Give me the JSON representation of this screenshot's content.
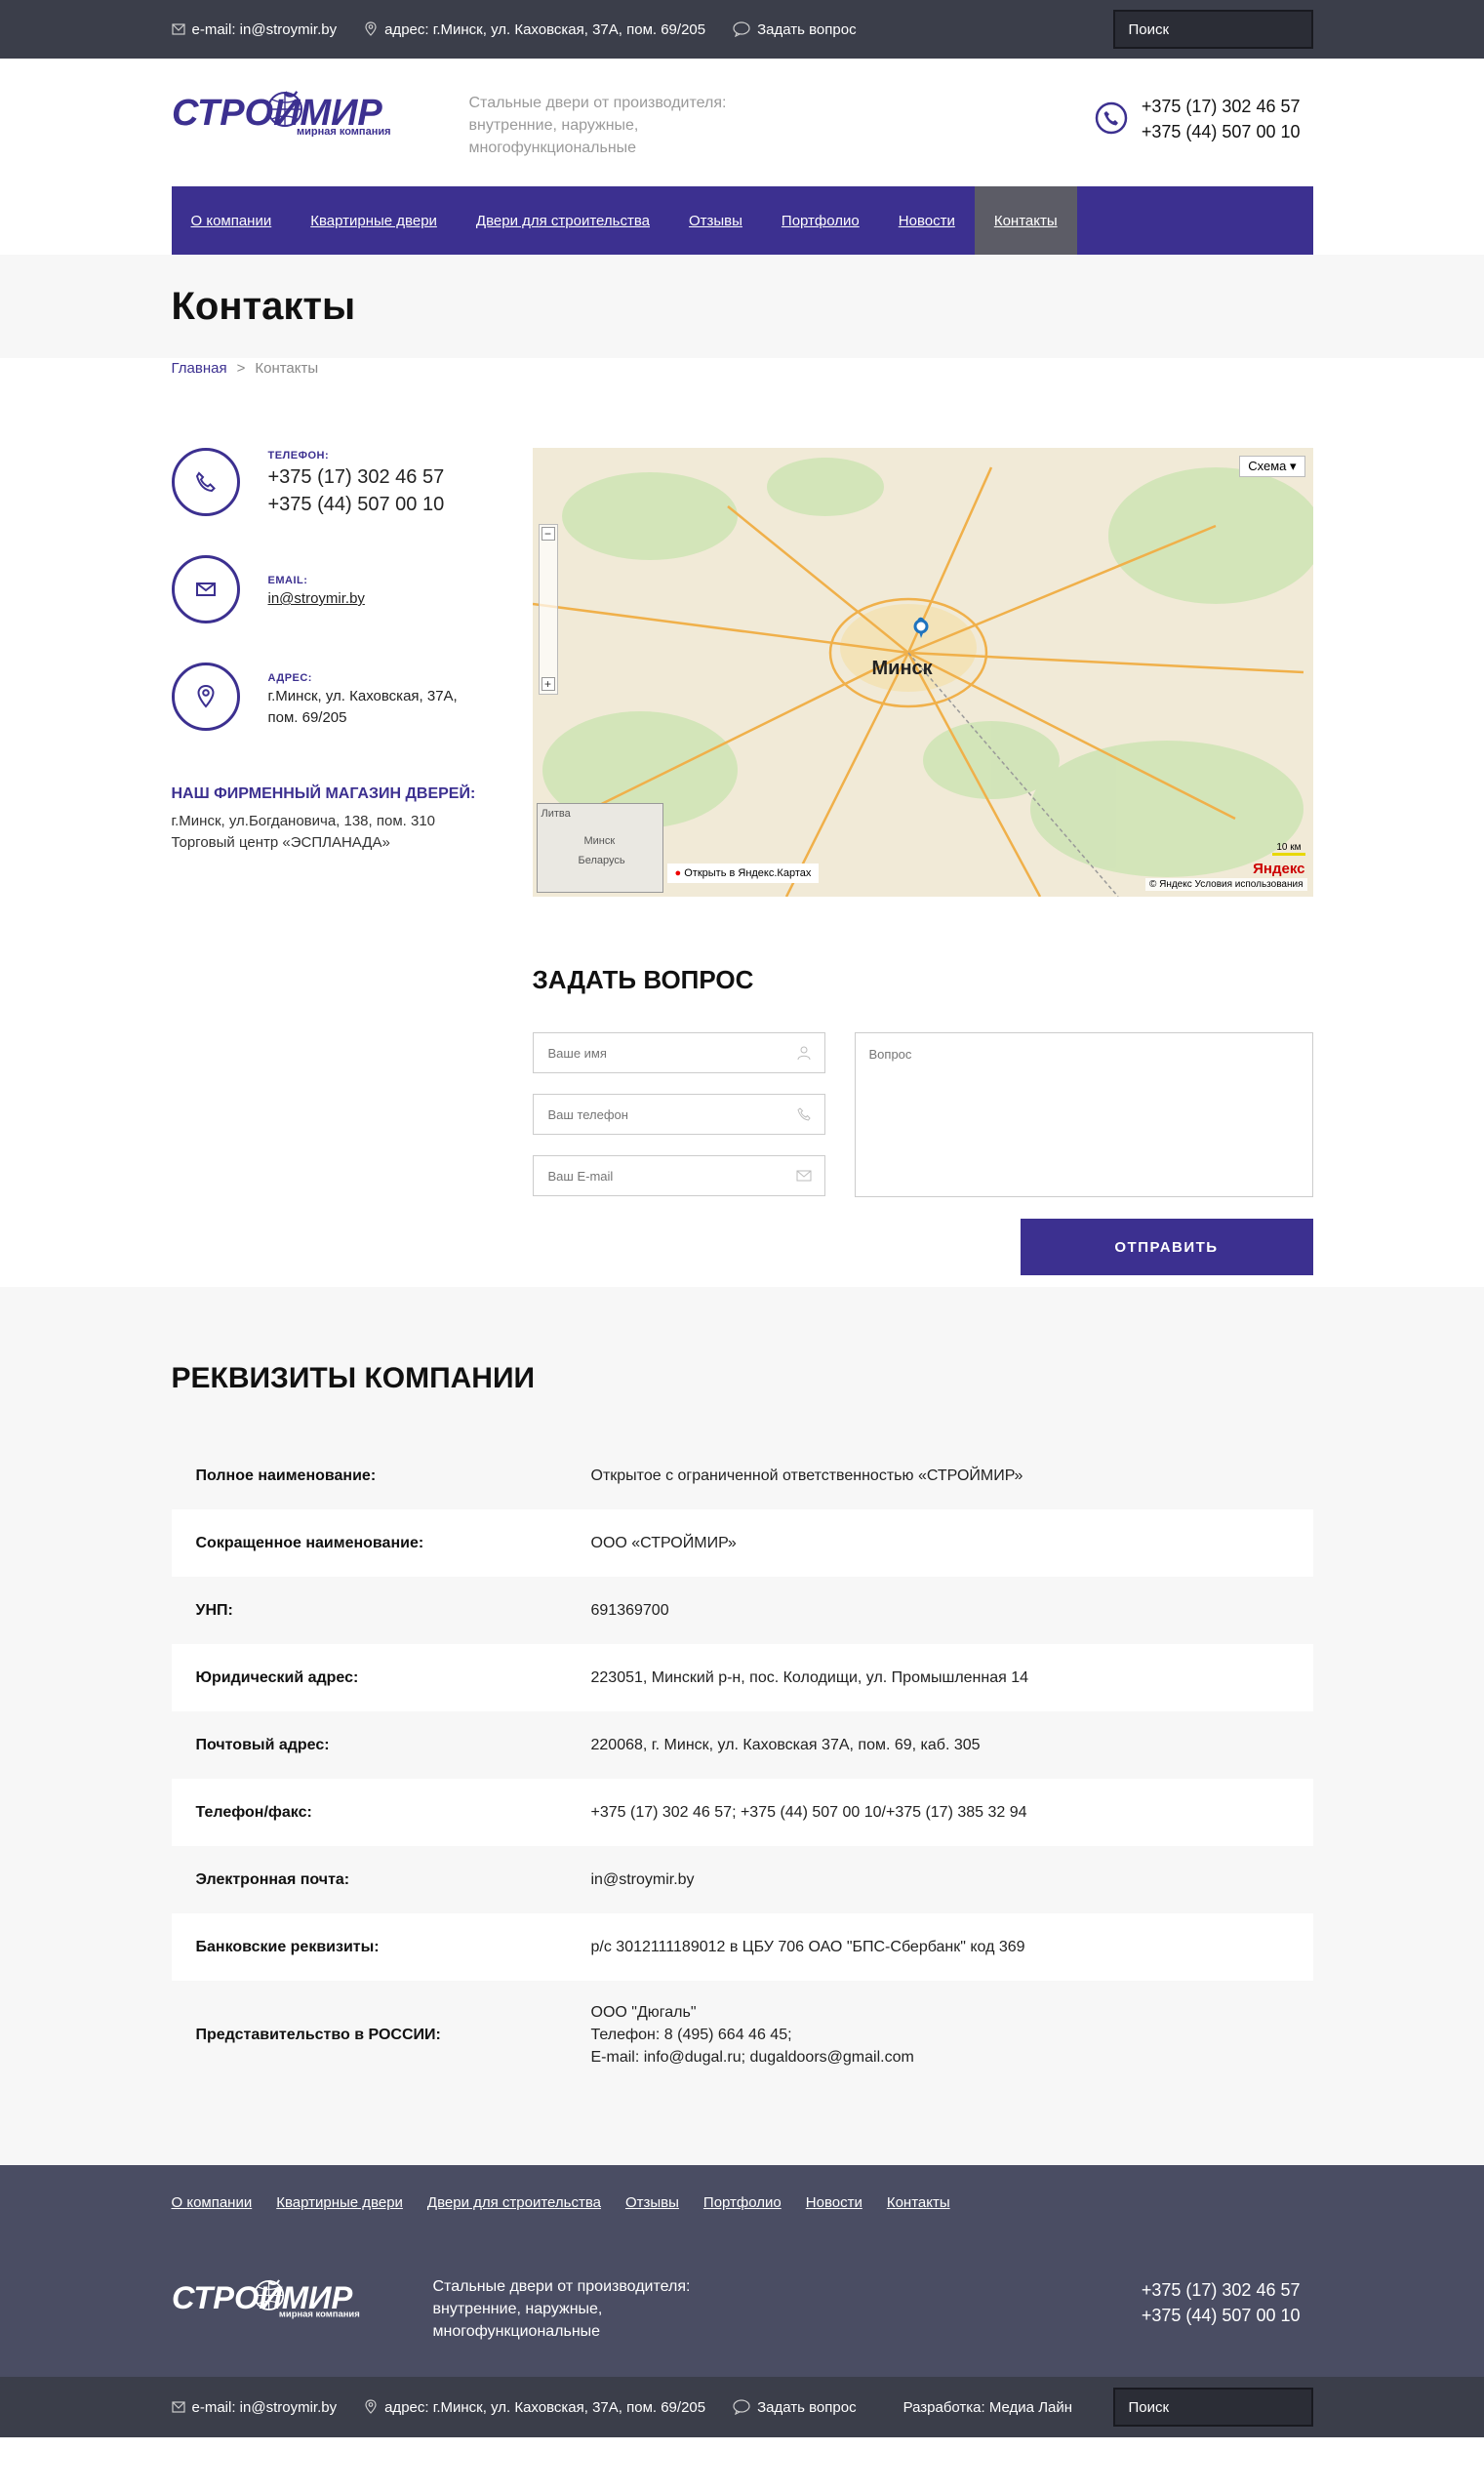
{
  "topbar": {
    "email": "e-mail: in@stroymir.by",
    "address": "адрес: г.Минск, ул. Каховская, 37А, пом. 69/205",
    "ask": "Задать вопрос",
    "search_placeholder": "Поиск"
  },
  "header": {
    "logo_text": "СТРОЙМИР",
    "logo_sub": "мирная компания",
    "tagline": "Стальные двери от производителя: внутренние, наружные, многофункциональные",
    "phone1": "+375 (17) 302 46 57",
    "phone2": "+375 (44) 507 00 10"
  },
  "nav": [
    {
      "label": "О компании",
      "active": false
    },
    {
      "label": "Квартирные двери",
      "active": false
    },
    {
      "label": "Двери для строительства",
      "active": false
    },
    {
      "label": "Отзывы",
      "active": false
    },
    {
      "label": "Портфолио",
      "active": false
    },
    {
      "label": "Новости",
      "active": false
    },
    {
      "label": "Контакты",
      "active": true
    }
  ],
  "page": {
    "title": "Контакты",
    "breadcrumb_home": "Главная",
    "breadcrumb_sep": ">",
    "breadcrumb_current": "Контакты"
  },
  "contacts": {
    "phone_label": "ТЕЛЕФОН:",
    "phone1": "+375 (17) 302 46 57",
    "phone2": "+375 (44) 507 00 10",
    "email_label": "EMAIL:",
    "email": "in@stroymir.by",
    "address_label": "АДРЕС:",
    "address": "г.Минск, ул. Каховская, 37А, пом. 69/205",
    "shop_title": "НАШ ФИРМЕННЫЙ МАГАЗИН ДВЕРЕЙ:",
    "shop_line1": "г.Минск, ул.Богдановича, 138, пом. 310",
    "shop_line2": "Торговый центр «ЭСПЛАНАДА»"
  },
  "map": {
    "scheme": "Схема ▾",
    "city": "Минск",
    "open": "Открыть в Яндекс.Картах",
    "copyright": "© Яндекс  Условия использования",
    "brand": "Яндекс",
    "scale": "10 км",
    "minimap_label1": "Литва",
    "minimap_label2": "Минск",
    "minimap_label3": "Беларусь"
  },
  "form": {
    "title": "ЗАДАТЬ ВОПРОС",
    "name_placeholder": "Ваше имя",
    "phone_placeholder": "Ваш телефон",
    "email_placeholder": "Ваш E-mail",
    "question_placeholder": "Вопрос",
    "submit": "ОТПРАВИТЬ"
  },
  "requisites": {
    "title": "РЕКВИЗИТЫ КОМПАНИИ",
    "rows": [
      {
        "k": "Полное наименование:",
        "v": "Открытое с ограниченной ответственностью «СТРОЙМИР»"
      },
      {
        "k": "Сокращенное наименование:",
        "v": "ООО «СТРОЙМИР»"
      },
      {
        "k": "УНП:",
        "v": "691369700"
      },
      {
        "k": "Юридический адрес:",
        "v": "223051, Минский р-н, пос. Колодищи, ул. Промышленная 14"
      },
      {
        "k": "Почтовый адрес:",
        "v": "220068, г. Минск, ул. Каховская 37А, пом. 69, каб. 305"
      },
      {
        "k": "Телефон/факс:",
        "v1": "+375 (17) 302 46 57",
        "v2": "+375 (44) 507 00 10",
        "v3": "+375 (17) 385 32 94"
      },
      {
        "k": "Электронная почта:",
        "v": "in@stroymir.by"
      },
      {
        "k": "Банковские реквизиты:",
        "v": "р/с 3012111189012 в ЦБУ 706 ОАО \"БПС-Сбербанк\" код 369"
      },
      {
        "k": "Представительство в РОССИИ:",
        "l1": "ООО \"Дюгаль\"",
        "l2": "Телефон: 8 (495) 664 46 45;",
        "l3": "E-mail:",
        "m1": "info@dugal.ru",
        "m2": "dugaldoors@gmail.com"
      }
    ]
  },
  "footer": {
    "nav": [
      "О компании",
      "Квартирные двери",
      "Двери для строительства",
      "Отзывы",
      "Портфолио",
      "Новости",
      "Контакты"
    ],
    "tagline": "Стальные двери от производителя: внутренние, наружные, многофункциональные",
    "phone1": "+375 (17) 302 46 57",
    "phone2": "+375 (44) 507 00 10",
    "dev_label": "Разработка:",
    "dev_link": "Медиа Лайн"
  },
  "colors": {
    "brand": "#3c3090",
    "topbar": "#3b3e4a",
    "footer": "#4a4d63"
  }
}
